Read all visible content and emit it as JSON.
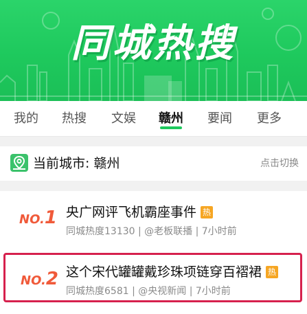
{
  "banner": {
    "title": "同城热搜",
    "bg_color": "#1ec95d"
  },
  "tabs": [
    {
      "label": "我的"
    },
    {
      "label": "热搜"
    },
    {
      "label": "文娱"
    },
    {
      "label": "赣州",
      "active": true
    },
    {
      "label": "要闻"
    },
    {
      "label": "更多"
    }
  ],
  "city": {
    "icon": "location-pin-icon",
    "label": "当前城市: 赣州",
    "switch_label": "点击切换"
  },
  "items": [
    {
      "rank_prefix": "NO.",
      "rank_num": "1",
      "title": "央广网评飞机霸座事件",
      "badge": "热",
      "meta": "同城热度13130 | @老板联播 | 7小时前"
    },
    {
      "rank_prefix": "NO.",
      "rank_num": "2",
      "title": "这个宋代罐罐戴珍珠项链穿百褶裙",
      "badge": "热",
      "meta": "同城热度6581 | @央视新闻 | 7小时前"
    }
  ],
  "colors": {
    "accent": "#1ec95d",
    "rank": "#f05a3a",
    "badge": "#f6a623",
    "highlight_border": "#d6204d"
  }
}
